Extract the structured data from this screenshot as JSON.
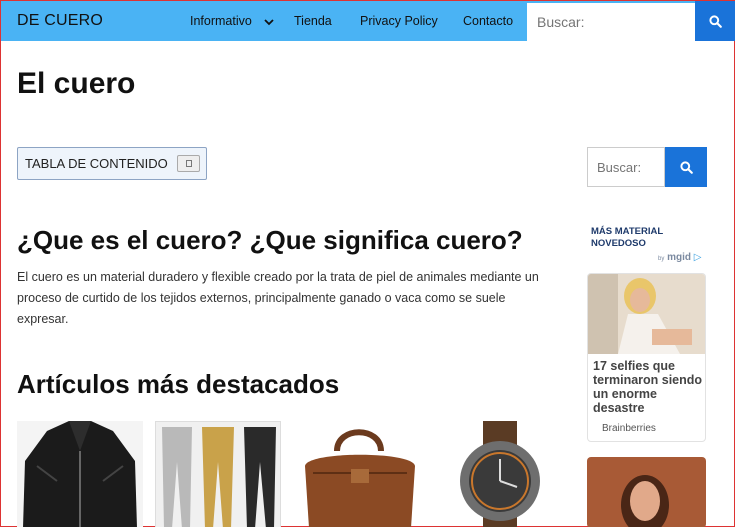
{
  "header": {
    "brand": "DE CUERO",
    "nav": [
      {
        "label": "Informativo"
      },
      {
        "label": "Tienda"
      },
      {
        "label": "Privacy Policy"
      },
      {
        "label": "Contacto"
      }
    ],
    "search_placeholder": "Buscar:"
  },
  "page": {
    "title": "El cuero",
    "toc_label": "TABLA DE CONTENIDO",
    "section1_title": "¿Que es el cuero? ¿Que significa cuero?",
    "section1_text": "El cuero es un material duradero y flexible creado por la trata de piel de animales mediante un proceso de curtido de los tejidos externos, principalmente ganado o vaca como se suele expresar.",
    "section2_title": "Artículos más destacados"
  },
  "sidebar": {
    "search_placeholder": "Buscar:",
    "widget_title": "MÁS MATERIAL NOVEDOSO",
    "widget_by": "by",
    "widget_brand": "mgid",
    "card_title": "17 selfies que terminaron siendo un enorme desastre",
    "card_source": "Brainberries"
  },
  "colors": {
    "topbar": "#4ab3f4",
    "accent": "#1a73d9"
  },
  "icons": {
    "search": "search-icon",
    "chevron": "chevron-down-icon"
  }
}
